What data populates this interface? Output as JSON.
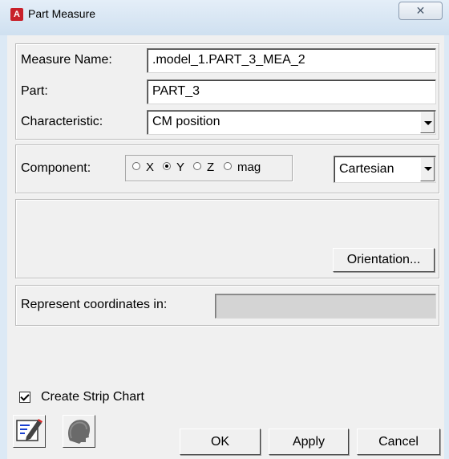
{
  "window": {
    "title": "Part Measure",
    "app_icon_letter": "A",
    "close_glyph": "✕"
  },
  "form": {
    "measure_name_label": "Measure Name:",
    "measure_name_value": ".model_1.PART_3_MEA_2",
    "part_label": "Part:",
    "part_value": "PART_3",
    "characteristic_label": "Characteristic:",
    "characteristic_value": "CM position"
  },
  "component": {
    "label": "Component:",
    "options": [
      "X",
      "Y",
      "Z",
      "mag"
    ],
    "selected": "Y",
    "coord_system": "Cartesian"
  },
  "orientation_button": "Orientation...",
  "represent": {
    "label": "Represent coordinates in:",
    "value": ""
  },
  "strip_chart": {
    "label": "Create Strip Chart",
    "checked": true
  },
  "buttons": {
    "ok": "OK",
    "apply": "Apply",
    "cancel": "Cancel"
  },
  "icons": [
    "edit-notes-icon",
    "head-silhouette-icon",
    "dropdown-arrow-icon",
    "close-icon"
  ],
  "colors": {
    "titlebar": "#dce9f5",
    "dialog_bg": "#f0f0f0",
    "app_icon": "#c8202a",
    "disabled_field": "#d4d4d4"
  }
}
